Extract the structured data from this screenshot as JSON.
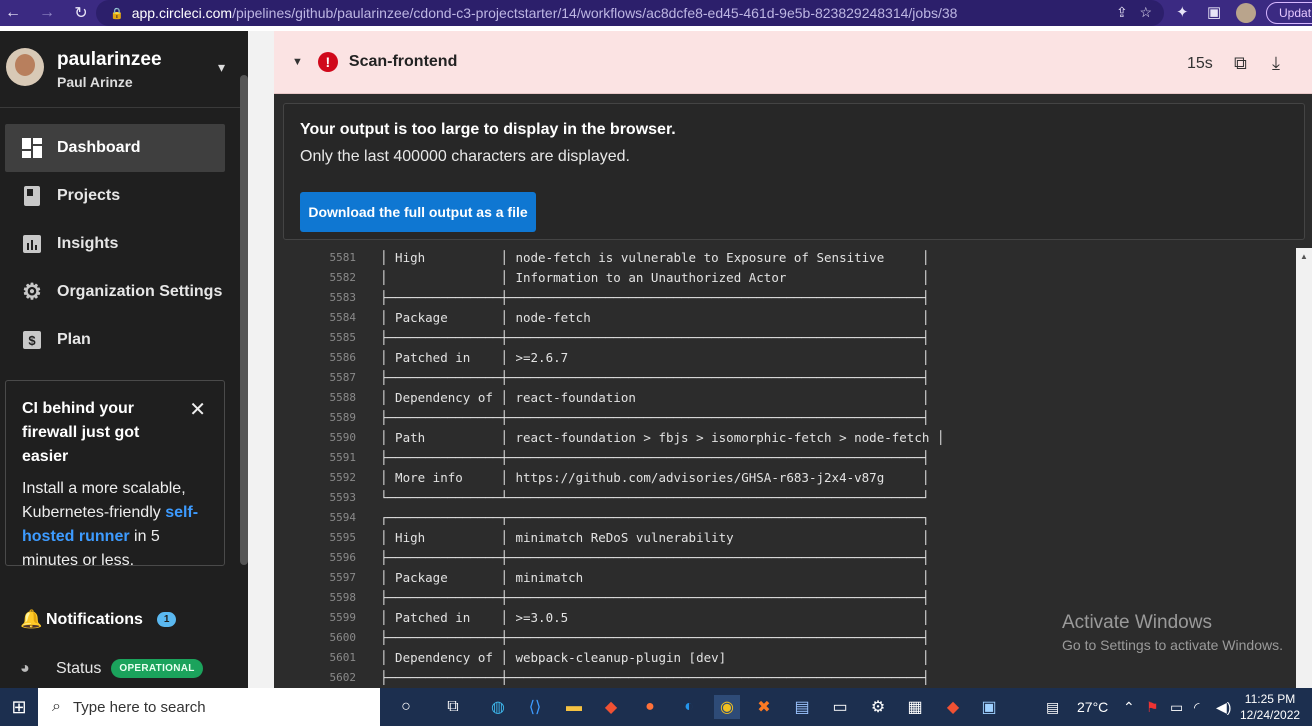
{
  "browser": {
    "url_host": "app.circleci.com",
    "url_path": "/pipelines/github/paularinzee/cdond-c3-projectstarter/14/workflows/ac8dcfe8-ed45-461d-9e5b-823829248314/jobs/38",
    "update_label": "Updat"
  },
  "sidebar": {
    "username": "paularinzee",
    "fullname": "Paul Arinze",
    "items": [
      {
        "label": "Dashboard",
        "icon": "dashboard-icon"
      },
      {
        "label": "Projects",
        "icon": "projects-icon"
      },
      {
        "label": "Insights",
        "icon": "insights-icon"
      },
      {
        "label": "Organization Settings",
        "icon": "gear-icon"
      },
      {
        "label": "Plan",
        "icon": "dollar-icon"
      }
    ],
    "promo": {
      "title": "CI behind your firewall just got easier",
      "body_prefix": "Install a more scalable, Kubernetes-friendly ",
      "link": "self-hosted runner",
      "body_suffix": " in 5 minutes or less."
    },
    "notifications_label": "Notifications",
    "notifications_count": "1",
    "status_label": "Status",
    "status_badge": "OPERATIONAL"
  },
  "job": {
    "name": "Scan-frontend",
    "duration": "15s"
  },
  "warning": {
    "line1": "Your output is too large to display in the browser.",
    "line2": "Only the last 400000 characters are displayed.",
    "button": "Download the full output as a file"
  },
  "log_lines": [
    {
      "n": "5581",
      "t": "│ High          │ node-fetch is vulnerable to Exposure of Sensitive     │"
    },
    {
      "n": "5582",
      "t": "│               │ Information to an Unauthorized Actor                  │"
    },
    {
      "n": "5583",
      "t": "├───────────────┼───────────────────────────────────────────────────────┤"
    },
    {
      "n": "5584",
      "t": "│ Package       │ node-fetch                                            │"
    },
    {
      "n": "5585",
      "t": "├───────────────┼───────────────────────────────────────────────────────┤"
    },
    {
      "n": "5586",
      "t": "│ Patched in    │ >=2.6.7                                               │"
    },
    {
      "n": "5587",
      "t": "├───────────────┼───────────────────────────────────────────────────────┤"
    },
    {
      "n": "5588",
      "t": "│ Dependency of │ react-foundation                                      │"
    },
    {
      "n": "5589",
      "t": "├───────────────┼───────────────────────────────────────────────────────┤"
    },
    {
      "n": "5590",
      "t": "│ Path          │ react-foundation > fbjs > isomorphic-fetch > node-fetch │"
    },
    {
      "n": "5591",
      "t": "├───────────────┼───────────────────────────────────────────────────────┤"
    },
    {
      "n": "5592",
      "t": "│ More info     │ https://github.com/advisories/GHSA-r683-j2x4-v87g     │"
    },
    {
      "n": "5593",
      "t": "└───────────────┴───────────────────────────────────────────────────────┘"
    },
    {
      "n": "5594",
      "t": "┌───────────────┬───────────────────────────────────────────────────────┐"
    },
    {
      "n": "5595",
      "t": "│ High          │ minimatch ReDoS vulnerability                         │"
    },
    {
      "n": "5596",
      "t": "├───────────────┼───────────────────────────────────────────────────────┤"
    },
    {
      "n": "5597",
      "t": "│ Package       │ minimatch                                             │"
    },
    {
      "n": "5598",
      "t": "├───────────────┼───────────────────────────────────────────────────────┤"
    },
    {
      "n": "5599",
      "t": "│ Patched in    │ >=3.0.5                                               │"
    },
    {
      "n": "5600",
      "t": "├───────────────┼───────────────────────────────────────────────────────┤"
    },
    {
      "n": "5601",
      "t": "│ Dependency of │ webpack-cleanup-plugin [dev]                          │"
    },
    {
      "n": "5602",
      "t": "├───────────────┼───────────────────────────────────────────────────────┤"
    }
  ],
  "watermark": {
    "line1": "Activate Windows",
    "line2": "Go to Settings to activate Windows."
  },
  "taskbar": {
    "search_placeholder": "Type here to search",
    "temperature": "27°C",
    "time": "11:25 PM",
    "date": "12/24/2022"
  }
}
